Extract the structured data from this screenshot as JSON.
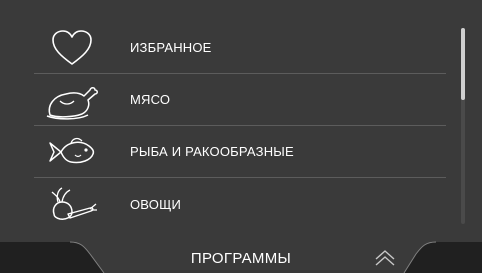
{
  "menu": {
    "items": [
      {
        "icon": "heart-icon",
        "label": "ИЗБРАННОЕ"
      },
      {
        "icon": "poultry-icon",
        "label": "МЯСО"
      },
      {
        "icon": "fish-icon",
        "label": "РЫБА И РАКООБРАЗНЫЕ"
      },
      {
        "icon": "vegetables-icon",
        "label": "ОВОЩИ"
      }
    ]
  },
  "bottom_bar": {
    "title": "ПРОГРАММЫ",
    "up_icon": "chevron-up-icon"
  },
  "colors": {
    "background": "#3a3a3a",
    "bottom_bar": "#202020",
    "text": "#ffffff",
    "divider": "#5c5c5c",
    "scrollbar_thumb": "#d0d0d0"
  }
}
